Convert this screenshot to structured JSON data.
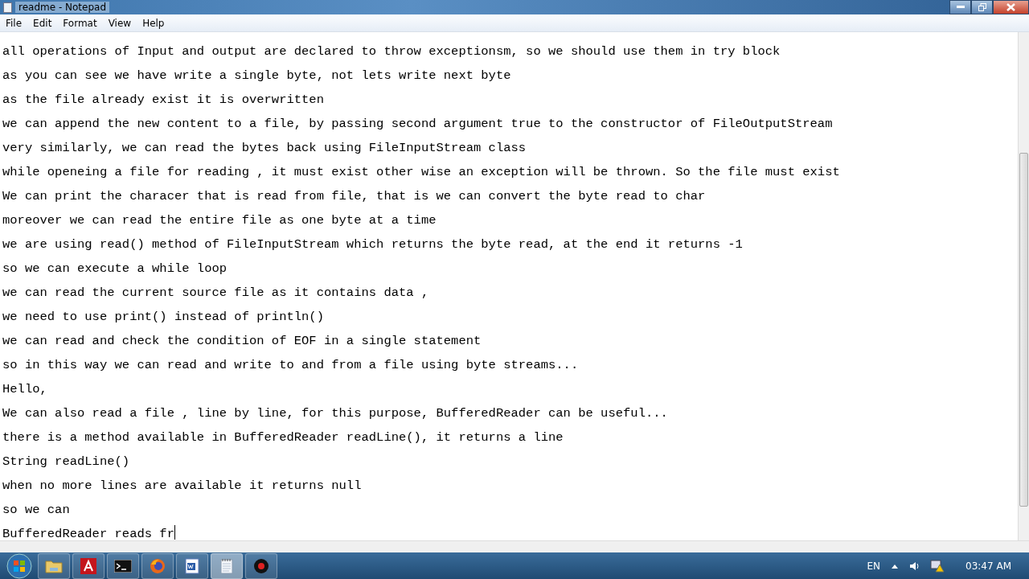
{
  "window": {
    "title": "readme - Notepad"
  },
  "menu": [
    {
      "label": "File"
    },
    {
      "label": "Edit"
    },
    {
      "label": "Format"
    },
    {
      "label": "View"
    },
    {
      "label": "Help"
    }
  ],
  "document": {
    "lines": [
      "all operations of Input and output are declared to throw exceptionsm, so we should use them in try block",
      "as you can see we have write a single byte, not lets write next byte",
      "as the file already exist it is overwritten",
      "we can append the new content to a file, by passing second argument true to the constructor of FileOutputStream",
      "very similarly, we can read the bytes back using FileInputStream class",
      "while openeing a file for reading , it must exist other wise an exception will be thrown. So the file must exist",
      "We can print the characer that is read from file, that is we can convert the byte read to char",
      "moreover we can read the entire file as one byte at a time",
      "we are using read() method of FileInputStream which returns the byte read, at the end it returns -1",
      "so we can execute a while loop",
      "we can read the current source file as it contains data ,",
      "we need to use print() instead of println()",
      "we can read and check the condition of EOF in a single statement",
      "so in this way we can read and write to and from a file using byte streams...",
      "Hello,",
      "We can also read a file , line by line, for this purpose, BufferedReader can be useful...",
      "there is a method available in BufferedReader readLine(), it returns a line",
      "String readLine()",
      "when no more lines are available it returns null",
      "so we can",
      "BufferedReader reads fr"
    ]
  },
  "taskbar": {
    "apps": [
      {
        "kind": "folder",
        "selected": false
      },
      {
        "kind": "pdf",
        "selected": false
      },
      {
        "kind": "console",
        "selected": false
      },
      {
        "kind": "browser",
        "selected": false
      },
      {
        "kind": "word",
        "selected": false
      },
      {
        "kind": "notepad",
        "selected": true
      },
      {
        "kind": "recorder",
        "selected": false
      }
    ],
    "language": "EN",
    "clock": "03:47 AM"
  }
}
